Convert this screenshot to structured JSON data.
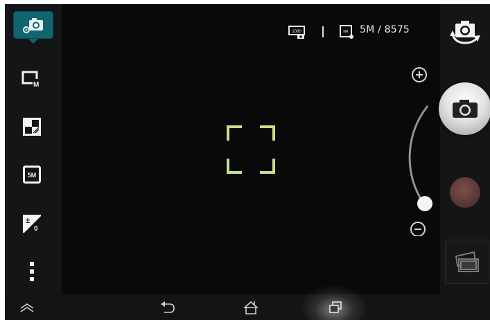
{
  "app": {
    "name": "Camera"
  },
  "left_rail": {
    "items": [
      {
        "name": "camera-mode",
        "icon": "camera-settings-icon",
        "selected": true
      },
      {
        "name": "metering",
        "icon": "metering-mode-icon",
        "badge": "M"
      },
      {
        "name": "white-balance",
        "icon": "exposure-compensation-icon"
      },
      {
        "name": "resolution",
        "icon": "resolution-icon",
        "label": "5M"
      },
      {
        "name": "exposure",
        "icon": "ev-icon",
        "label": "±0"
      },
      {
        "name": "more",
        "icon": "more-vertical-icon"
      }
    ]
  },
  "status": {
    "video_icon": "video-quality-icon",
    "photo_icon": "photo-size-icon",
    "photo_badge": "NR",
    "video_badge": "1080",
    "resolution_and_count": "5M / 8575"
  },
  "zoom": {
    "plus_icon": "zoom-in-icon",
    "minus_icon": "zoom-out-icon",
    "level": 0
  },
  "right_rail": {
    "switch_icon": "switch-camera-icon",
    "shutter_icon": "camera-shutter-icon",
    "record_icon": "record-video-icon",
    "gallery_icon": "gallery-icon"
  },
  "nav": {
    "items": [
      "collapse-up-icon",
      "back-icon",
      "home-icon",
      "recent-apps-icon"
    ]
  },
  "colors": {
    "accent": "#11656f",
    "focus": "#c8df8a",
    "record": "#5b3737"
  }
}
